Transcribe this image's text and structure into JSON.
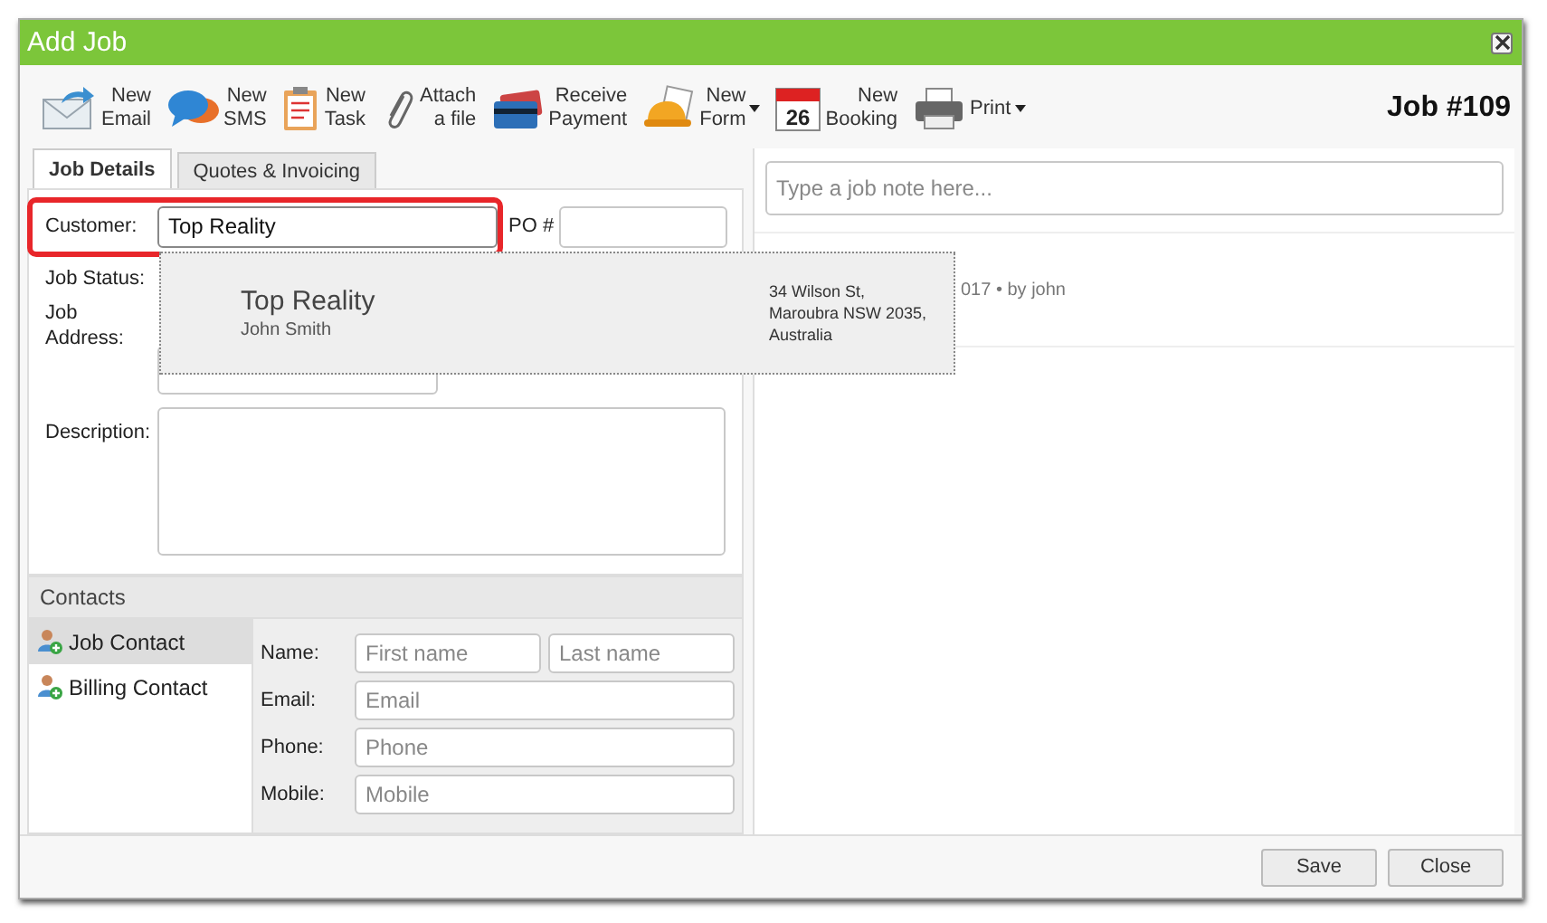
{
  "window": {
    "title": "Add Job"
  },
  "toolbar": [
    {
      "kind": "email",
      "lines": [
        "New",
        "Email"
      ],
      "dropdown": false
    },
    {
      "kind": "sms",
      "lines": [
        "New",
        "SMS"
      ],
      "dropdown": false
    },
    {
      "kind": "task",
      "lines": [
        "New",
        "Task"
      ],
      "dropdown": false
    },
    {
      "kind": "attach",
      "lines": [
        "Attach",
        "a file"
      ],
      "dropdown": false
    },
    {
      "kind": "payment",
      "lines": [
        "Receive",
        "Payment"
      ],
      "dropdown": false
    },
    {
      "kind": "form",
      "lines": [
        "New",
        "Form"
      ],
      "dropdown": true
    },
    {
      "kind": "booking",
      "day": "26",
      "lines": [
        "New",
        "Booking"
      ],
      "dropdown": false
    },
    {
      "kind": "print",
      "lines": [
        "Print"
      ],
      "dropdown": true
    }
  ],
  "job_number": "Job #109",
  "tabs": [
    {
      "label": "Job Details",
      "selected": true
    },
    {
      "label": "Quotes & Invoicing",
      "selected": false
    }
  ],
  "form": {
    "customer_label": "Customer:",
    "customer_value": "Top Reality",
    "po_label": "PO #",
    "job_status_label": "Job Status:",
    "job_address_label": [
      "Job",
      "Address:"
    ],
    "description_label": "Description:"
  },
  "suggestion": {
    "name": "Top Reality",
    "contact": "John Smith",
    "address": [
      "34 Wilson St,",
      "Maroubra NSW 2035,",
      "Australia"
    ]
  },
  "contacts": {
    "title": "Contacts",
    "items": [
      {
        "label": "Job Contact",
        "selected": true
      },
      {
        "label": "Billing Contact",
        "selected": false
      }
    ],
    "fields": [
      {
        "label": "Name:",
        "placeholders": [
          "First name",
          "Last name"
        ]
      },
      {
        "label": "Email:",
        "placeholders": [
          "Email"
        ]
      },
      {
        "label": "Phone:",
        "placeholders": [
          "Phone"
        ]
      },
      {
        "label": "Mobile:",
        "placeholders": [
          "Mobile"
        ]
      }
    ]
  },
  "notes": {
    "placeholder": "Type a job note here...",
    "entries": [
      {
        "meta": "017 •  by john"
      }
    ]
  },
  "buttons": [
    "Save",
    "Close"
  ]
}
